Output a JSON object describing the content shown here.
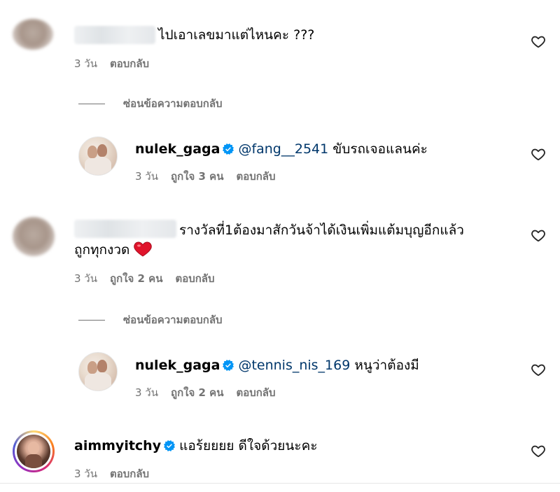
{
  "comments": [
    {
      "id": "c1",
      "text": "ไปเอาเลขมาแต่ไหนคะ ???",
      "time": "3 วัน",
      "reply_label": "ตอบกลับ",
      "hide_replies_label": "ซ่อนข้อความตอบกลับ",
      "reply": {
        "username": "nulek_gaga",
        "mention": "@fang__2541",
        "text": "ขับรถเจอแลนค่ะ",
        "time": "3 วัน",
        "likes": "ถูกใจ 3 คน",
        "reply_label": "ตอบกลับ"
      }
    },
    {
      "id": "c2",
      "text_line1": "รางวัลที่1ต้องมาสักวันจ้าได้เงินเพิ่มแต้มบุญอีกแล้ว",
      "text_line2": "ถูกทุกงวด",
      "emoji": "red-heart",
      "time": "3 วัน",
      "likes": "ถูกใจ 2 คน",
      "reply_label": "ตอบกลับ",
      "hide_replies_label": "ซ่อนข้อความตอบกลับ",
      "reply": {
        "username": "nulek_gaga",
        "mention": "@tennis_nis_169",
        "text": "หนูว่าต้องมี",
        "time": "3 วัน",
        "likes": "ถูกใจ 2 คน",
        "reply_label": "ตอบกลับ"
      }
    },
    {
      "id": "c3",
      "username": "aimmyitchy",
      "text": "แอร้ยยยย ดีใจด้วยนะคะ",
      "time": "3 วัน",
      "reply_label": "ตอบกลับ"
    }
  ],
  "icons": {
    "like": "heart-outline-icon",
    "verified": "verified-badge-icon"
  },
  "colors": {
    "meta": "#737373",
    "mention": "#00376b",
    "verified": "#0095f6",
    "emoji_heart": "#e0142b"
  }
}
